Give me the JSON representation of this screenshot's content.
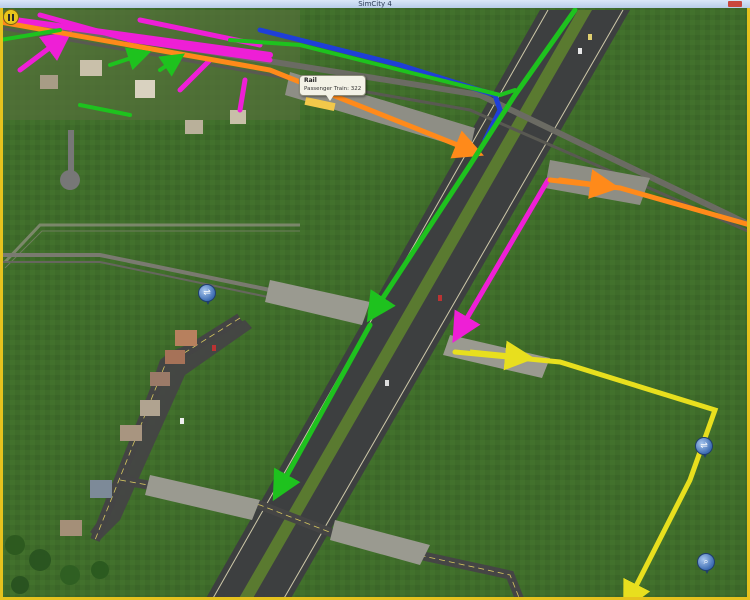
{
  "window": {
    "title": "SimCity 4"
  },
  "tooltip": {
    "title": "Rail",
    "detail": "Passenger Train: 322"
  },
  "controls": {
    "pause_glyph": "pause-icon"
  },
  "query_bubbles": [
    {
      "icon": "car-icon"
    },
    {
      "icon": "train-icon"
    },
    {
      "icon": "magnifier-icon"
    }
  ],
  "route_colors": {
    "green": "#1ec21e",
    "magenta": "#ee1fd6",
    "orange": "#ff8a1a",
    "blue": "#1f3fd8",
    "yellow": "#e8df1e"
  },
  "frame_color": "#e6c21e"
}
